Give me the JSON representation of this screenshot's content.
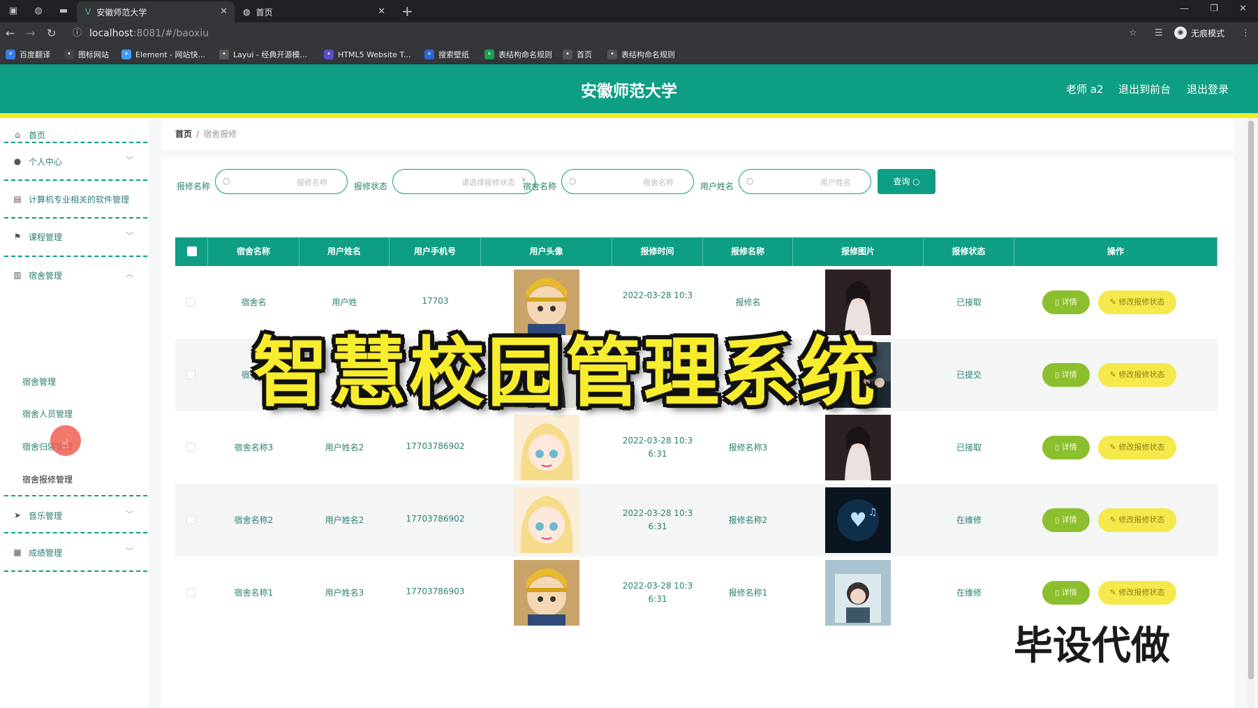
{
  "browser": {
    "tabs": [
      {
        "title": "安徽师范大学",
        "active": true
      },
      {
        "title": "首页",
        "active": false
      }
    ],
    "url_host": "localhost",
    "url_rest": ":8081/#/baoxiu",
    "incognito_label": "无痕模式",
    "bookmarks": [
      {
        "label": "百度翻译",
        "icon": "translate-icon",
        "color": "#3b7be8"
      },
      {
        "label": "图标网站",
        "icon": "flag-icon",
        "color": "#444444"
      },
      {
        "label": "Element - 网站快...",
        "icon": "element-icon",
        "color": "#409eff"
      },
      {
        "label": "Layui - 经典开源模...",
        "icon": "layui-icon",
        "color": "#5a5a5a"
      },
      {
        "label": "HTML5 Website T...",
        "icon": "html5-icon",
        "color": "#5b4fc9"
      },
      {
        "label": "搜索壁纸",
        "icon": "wallpaper-icon",
        "color": "#2f66d6"
      },
      {
        "label": "表结构命名规则",
        "icon": "table-icon",
        "color": "#1f9d55"
      },
      {
        "label": "首页",
        "icon": "globe-icon",
        "color": "#555555"
      },
      {
        "label": "表结构命名规则",
        "icon": "globe-icon",
        "color": "#555555"
      }
    ]
  },
  "header": {
    "brand": "安徽师范大学",
    "user": "老师 a2",
    "to_front": "退出到前台",
    "logout": "退出登录"
  },
  "sidebar": {
    "items": [
      {
        "label": "首页",
        "icon": "home-icon",
        "arrow": ""
      },
      {
        "label": "个人中心",
        "icon": "user-icon",
        "arrow": "﹀"
      },
      {
        "label": "计算机专业相关的软件管理",
        "icon": "briefcase-icon",
        "arrow": ""
      },
      {
        "label": "课程管理",
        "icon": "flag-icon",
        "arrow": "﹀"
      },
      {
        "label": "宿舍管理",
        "icon": "bar-chart-icon",
        "arrow": "︿"
      },
      {
        "label": "音乐管理",
        "icon": "send-icon",
        "arrow": "﹀"
      },
      {
        "label": "成绩管理",
        "icon": "grid-icon",
        "arrow": "﹀"
      }
    ],
    "sub_items": [
      "宿舍管理",
      "宿舍人员管理",
      "宿舍归寝管理",
      "宿舍报修管理"
    ]
  },
  "breadcrumb": {
    "home": "首页",
    "sep": "/",
    "current": "宿舍报修"
  },
  "search": {
    "fields": [
      {
        "label": "报修名称",
        "placeholder": "报修名称",
        "type": "input"
      },
      {
        "label": "报修状态",
        "placeholder": "请选择报修状态",
        "type": "select"
      },
      {
        "label": "宿舍名称",
        "placeholder": "宿舍名称",
        "type": "input"
      },
      {
        "label": "用户姓名",
        "placeholder": "用户姓名",
        "type": "input"
      }
    ],
    "button": "查询"
  },
  "table": {
    "columns": [
      "宿舍名称",
      "用户姓名",
      "用户手机号",
      "用户头像",
      "报修时间",
      "报修名称",
      "报修图片",
      "报修状态",
      "操作"
    ],
    "rows": [
      {
        "dorm": "宿舍名",
        "user": "用户姓",
        "phone": "17703",
        "time1": "2022-03-28 10:3",
        "time2": "",
        "repair": "报修名",
        "status": "已接取",
        "avatar": "boy",
        "photo": "portrait"
      },
      {
        "dorm": "宿舍名",
        "user": "",
        "phone": "",
        "time1": "",
        "time2": "6:31",
        "repair": "",
        "status": "已提交",
        "avatar": "girl-dark",
        "photo": "group"
      },
      {
        "dorm": "宿舍名称3",
        "user": "用户姓名2",
        "phone": "17703786902",
        "time1": "2022-03-28 10:3",
        "time2": "6:31",
        "repair": "报修名称3",
        "status": "已接取",
        "avatar": "blonde",
        "photo": "portrait"
      },
      {
        "dorm": "宿舍名称2",
        "user": "用户姓名2",
        "phone": "17703786902",
        "time1": "2022-03-28 10:3",
        "time2": "6:31",
        "repair": "报修名称2",
        "status": "在维修",
        "avatar": "blonde",
        "photo": "music"
      },
      {
        "dorm": "宿舍名称1",
        "user": "用户姓名3",
        "phone": "17703786903",
        "time1": "2022-03-28 10:3",
        "time2": "6:31",
        "repair": "报修名称1",
        "status": "在维修",
        "avatar": "boy",
        "photo": "cover"
      }
    ],
    "detail_label": "详情",
    "edit_label": "修改报修状态"
  },
  "overlay": {
    "title": "智慧校园管理系统",
    "subtitle": "毕设代做"
  }
}
